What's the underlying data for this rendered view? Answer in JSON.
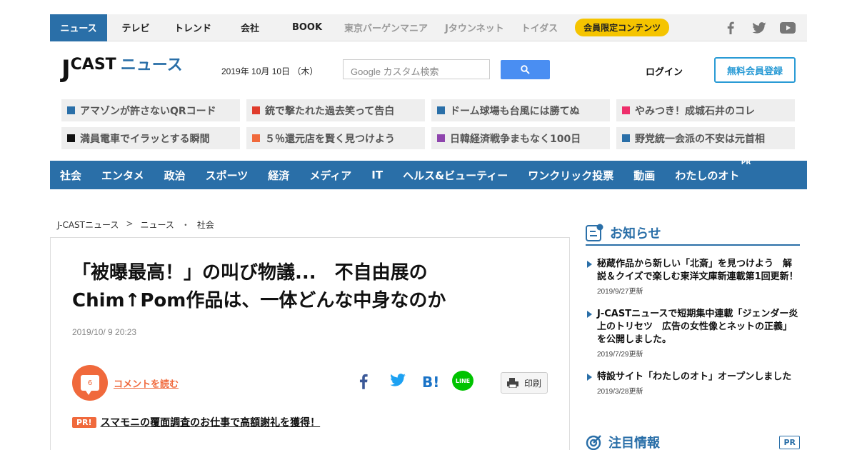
{
  "topnav": {
    "items": [
      "ニュース",
      "テレビ",
      "トレンド",
      "会社",
      "BOOK"
    ],
    "external": [
      "東京バーゲンマニア",
      "Jタウンネット",
      "トイダス"
    ],
    "member_badge": "会員限定コンテンツ"
  },
  "header": {
    "logo_j": "J",
    "logo_cast": "CAST",
    "logo_news": "ニュース",
    "date": "2019年 10月 10日 （木）",
    "search_placeholder": "Google カスタム検索",
    "login": "ログイン",
    "register": "無料会員登録"
  },
  "tags": [
    {
      "label": "アマゾンが許さないQRコード",
      "color": "#2a6fa8"
    },
    {
      "label": "銃で撃たれた過去笑って告白",
      "color": "#e03c2c"
    },
    {
      "label": "ドーム球場も台風には勝てぬ",
      "color": "#2a6fa8"
    },
    {
      "label": "やみつき！成城石井のコレ",
      "color": "#ee2e6b"
    },
    {
      "label": "満員電車でイラッとする瞬間",
      "color": "#111111"
    },
    {
      "label": "５％還元店を賢く見つけよう",
      "color": "#f0693c"
    },
    {
      "label": "日韓経済戦争まもなく100日",
      "color": "#8e44ad"
    },
    {
      "label": "野党統一会派の不安は元首相",
      "color": "#2a6fa8"
    }
  ],
  "categories": [
    "社会",
    "エンタメ",
    "政治",
    "スポーツ",
    "経済",
    "メディア",
    "IT",
    "ヘルス&ビューティー",
    "ワンクリック投票",
    "動画",
    "わたしのオト"
  ],
  "category_pr": "PR",
  "breadcrumb": [
    "J-CASTニュース",
    ">",
    "ニュース",
    "・",
    "社会"
  ],
  "article": {
    "title_line1": "「被曝最高！」の叫び物議...　不自由展の",
    "title_line2": "Chim↑Pom作品は、一体どんな中身なのか",
    "date": "2019/10/ 9 20:23",
    "comment_count": "6",
    "comment_link": "コメントを読む",
    "share_hatena": "B!",
    "share_line": "LINE",
    "print": "印刷",
    "pr_badge": "PR!",
    "pr_text": "スマモニの覆面調査のお仕事で高額謝礼を獲得！"
  },
  "sidebar": {
    "notice_title": "お知らせ",
    "notices": [
      {
        "text": "秘蔵作品から新しい「北斎」を見つけよう　解説＆クイズで楽しむ東洋文庫新連載第1回更新！",
        "date": "2019/9/27更新"
      },
      {
        "text": "J-CASTニュースで短期集中連載「ジェンダー炎上のトリセツ　広告の女性像とネットの正義」を公開しました。",
        "date": "2019/7/29更新"
      },
      {
        "text": "特設サイト「わたしのオト」オープンしました",
        "date": "2019/3/28更新"
      }
    ],
    "featured_title": "注目情報",
    "featured_pr": "PR"
  },
  "colors": {
    "brand": "#2a6fa8",
    "accent": "#f0693c",
    "badge": "#f5c400"
  }
}
